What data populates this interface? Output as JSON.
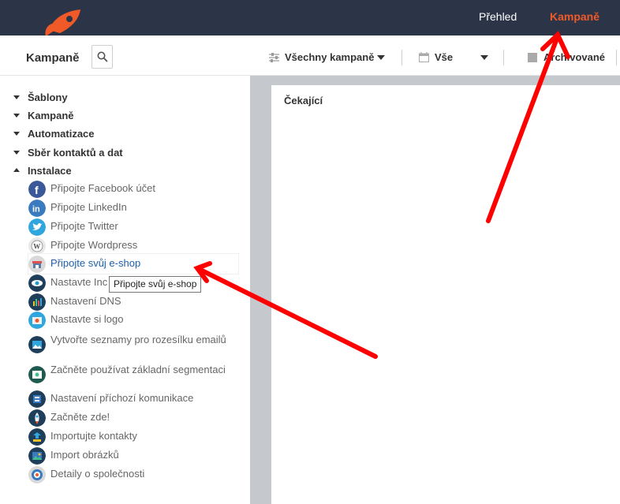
{
  "topbar": {
    "nav": [
      {
        "label": "Přehled"
      },
      {
        "label": "Kampaně"
      }
    ]
  },
  "header": {
    "title": "Kampaně",
    "filters": {
      "campaigns": "Všechny kampaně",
      "all": "Vše",
      "archived": "Archivované"
    }
  },
  "sidebar": {
    "sections": [
      {
        "label": "Šablony"
      },
      {
        "label": "Kampaně"
      },
      {
        "label": "Automatizace"
      },
      {
        "label": "Sběr kontaktů a dat"
      },
      {
        "label": "Instalace"
      }
    ],
    "items": [
      {
        "label": "Připojte Facebook účet",
        "icon": "facebook-icon"
      },
      {
        "label": "Připojte LinkedIn",
        "icon": "linkedin-icon"
      },
      {
        "label": "Připojte Twitter",
        "icon": "twitter-icon"
      },
      {
        "label": "Připojte Wordpress",
        "icon": "wordpress-icon"
      },
      {
        "label": "Připojte svůj e-shop",
        "icon": "shop-icon"
      },
      {
        "label": "Nastavte Inc",
        "icon": "eye-icon"
      },
      {
        "label": "Nastavení DNS",
        "icon": "dns-icon"
      },
      {
        "label": "Nastavte si logo",
        "icon": "logo-icon"
      },
      {
        "label": "Vytvořte seznamy pro rozesílku emailů",
        "icon": "list-icon"
      },
      {
        "label": "Začněte používat základní segmentaci",
        "icon": "segment-icon"
      },
      {
        "label": "Nastavení příchozí komunikace",
        "icon": "inbox-icon"
      },
      {
        "label": "Začněte zde!",
        "icon": "rocket-icon"
      },
      {
        "label": "Importujte kontakty",
        "icon": "import-icon"
      },
      {
        "label": "Import obrázků",
        "icon": "image-icon"
      },
      {
        "label": "Detaily o společnosti",
        "icon": "company-icon"
      }
    ],
    "tooltip": "Připojte svůj e-shop"
  },
  "main": {
    "panel_title": "Čekající"
  },
  "colors": {
    "topbar": "#2c3447",
    "accent": "#f05a28",
    "annotation": "#ff0000",
    "content_bg": "#c5c8cd"
  }
}
